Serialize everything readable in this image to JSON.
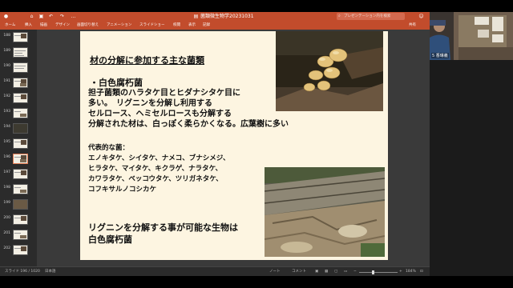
{
  "title_bar": {
    "doc_title": "菌類微生物学20231031",
    "search_placeholder": "プレゼンテーション内を検索"
  },
  "ribbon": {
    "tabs": [
      "ホーム",
      "挿入",
      "描画",
      "デザイン",
      "画面切り替え",
      "アニメーション",
      "スライドショー",
      "校閲",
      "表示",
      "記録"
    ],
    "share_label": "共有"
  },
  "thumbnails": {
    "numbers": [
      "188",
      "189",
      "190",
      "191",
      "192",
      "193",
      "194",
      "195",
      "196",
      "197",
      "198",
      "199",
      "200",
      "201",
      "202"
    ],
    "selected": "196"
  },
  "slide": {
    "title": "材の分解に参加する主な菌類",
    "bullet": "・白色腐朽菌",
    "body": [
      "担子菌類のハラタケ目とヒダナシタケ目に",
      "多い。　リグニンを分解し利用する",
      "セルロース、ヘミセルロースも分解する",
      "分解された材は、白っぽく柔らかくなる。広葉樹に多い"
    ],
    "examples_heading": "代表的な菌：",
    "examples": [
      "エノキタケ、シイタケ、ナメコ、ブナシメジ、",
      "ヒラタケ、マイタケ、キクラゲ、ナラタケ、",
      "カワラタケ、ベッコウタケ、ツリガネタケ、",
      "コフキサルノコシカケ"
    ],
    "conclusion": [
      "リグニンを分解する事が可能な生物は",
      "白色腐朽菌"
    ]
  },
  "status_bar": {
    "slide_info": "スライド 196 / 1020",
    "language": "日本語",
    "notes": "ノート",
    "comments": "コメント",
    "zoom_level": 0.35,
    "zoom": "184%"
  },
  "video": {
    "name": "5 香琳義",
    "background_color": "#6f5e4e"
  },
  "colors": {
    "accent": "#c24c2c",
    "slide_bg": "#fdf5e1"
  }
}
